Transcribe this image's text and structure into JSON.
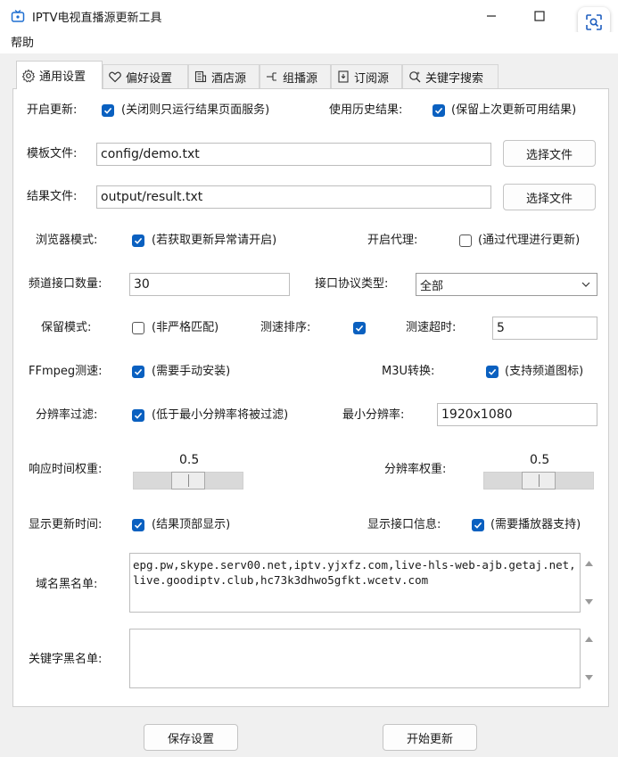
{
  "window": {
    "title": "IPTV电视直播源更新工具"
  },
  "menu": {
    "help": "帮助"
  },
  "tabs": [
    {
      "label": "通用设置",
      "icon": "gear-icon"
    },
    {
      "label": "偏好设置",
      "icon": "heart-icon"
    },
    {
      "label": "酒店源",
      "icon": "building-icon"
    },
    {
      "label": "组播源",
      "icon": "branch-icon"
    },
    {
      "label": "订阅源",
      "icon": "bookmark-icon"
    },
    {
      "label": "关键字搜索",
      "icon": "search-icon"
    }
  ],
  "settings": {
    "open_update": {
      "label": "开启更新:",
      "checked": true,
      "desc": "(关闭则只运行结果页面服务)"
    },
    "use_history": {
      "label": "使用历史结果:",
      "checked": true,
      "desc": "(保留上次更新可用结果)"
    },
    "template_file": {
      "label": "模板文件:",
      "value": "config/demo.txt",
      "button": "选择文件"
    },
    "result_file": {
      "label": "结果文件:",
      "value": "output/result.txt",
      "button": "选择文件"
    },
    "browser_mode": {
      "label": "浏览器模式:",
      "checked": true,
      "desc": "(若获取更新异常请开启)"
    },
    "proxy": {
      "label": "开启代理:",
      "checked": false,
      "desc": "(通过代理进行更新)"
    },
    "channel_count": {
      "label": "频道接口数量:",
      "value": "30"
    },
    "protocol": {
      "label": "接口协议类型:",
      "selected": "全部"
    },
    "keep_mode": {
      "label": "保留模式:",
      "checked": false,
      "desc": "(非严格匹配)"
    },
    "speed_sort": {
      "label": "测速排序:",
      "checked": true
    },
    "speed_timeout": {
      "label": "测速超时:",
      "value": "5"
    },
    "ffmpeg": {
      "label": "FFmpeg测速:",
      "checked": true,
      "desc": "(需要手动安装)"
    },
    "m3u": {
      "label": "M3U转换:",
      "checked": true,
      "desc": "(支持频道图标)"
    },
    "resolution_filter": {
      "label": "分辨率过滤:",
      "checked": true,
      "desc": "(低于最小分辨率将被过滤)"
    },
    "min_resolution": {
      "label": "最小分辨率:",
      "value": "1920x1080"
    },
    "response_weight": {
      "label": "响应时间权重:",
      "value": "0.5",
      "fraction": 0.5
    },
    "resolution_weight": {
      "label": "分辨率权重:",
      "value": "0.5",
      "fraction": 0.5
    },
    "show_update_time": {
      "label": "显示更新时间:",
      "checked": true,
      "desc": "(结果顶部显示)"
    },
    "show_interface_info": {
      "label": "显示接口信息:",
      "checked": true,
      "desc": "(需要播放器支持)"
    },
    "domain_blacklist": {
      "label": "域名黑名单:",
      "value": "epg.pw,skype.serv00.net,iptv.yjxfz.com,live-hls-web-ajb.getaj.net,live.goodiptv.club,hc73k3dhwo5gfkt.wcetv.com"
    },
    "keyword_blacklist": {
      "label": "关键字黑名单:",
      "value": ""
    }
  },
  "footer": {
    "save": "保存设置",
    "start": "开始更新"
  },
  "colors": {
    "checkbox": "#0a60c0",
    "panel": "#ffffff",
    "window": "#f0f0f0"
  }
}
